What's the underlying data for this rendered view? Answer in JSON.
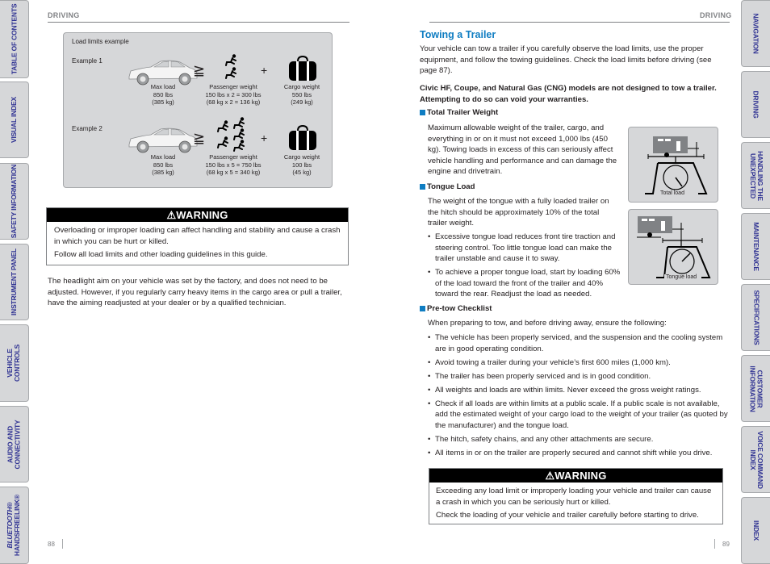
{
  "left_tabs": [
    {
      "label": "TABLE OF CONTENTS"
    },
    {
      "label": "VISUAL INDEX"
    },
    {
      "label": "SAFETY INFORMATION"
    },
    {
      "label": "INSTRUMENT PANEL"
    },
    {
      "label": "VEHICLE\nCONTROLS"
    },
    {
      "label": "AUDIO AND\nCONNECTIVITY"
    },
    {
      "label": "BLUETOOTH®\nHANDSFREELINK®"
    }
  ],
  "right_tabs": [
    {
      "label": "NAVIGATION"
    },
    {
      "label": "DRIVING"
    },
    {
      "label": "HANDLING THE\nUNEXPECTED"
    },
    {
      "label": "MAINTENANCE"
    },
    {
      "label": "SPECIFICATIONS"
    },
    {
      "label": "CUSTOMER\nINFORMATION"
    },
    {
      "label": "VOICE COMMAND\nINDEX"
    },
    {
      "label": "INDEX"
    }
  ],
  "left_page": {
    "section_header": "DRIVING",
    "page_number": "88",
    "figure": {
      "title": "Load limits example",
      "examples": [
        {
          "label": "Example 1",
          "passenger_count": 2,
          "max_load": "Max load\n850 lbs\n(385 kg)",
          "passenger_weight": "Passenger weight\n150 lbs x 2 = 300 lbs\n(68 kg x 2 = 136 kg)",
          "cargo_weight": "Cargo weight\n550 lbs\n(249 kg)"
        },
        {
          "label": "Example 2",
          "passenger_count": 5,
          "max_load": "Max load\n850 lbs\n(385 kg)",
          "passenger_weight": "Passenger weight\n150 lbs x 5 = 750 lbs\n(68 kg x 5 = 340 kg)",
          "cargo_weight": "Cargo weight\n100 lbs\n(45 kg)"
        }
      ],
      "operator_geq": "≧",
      "operator_plus": "+"
    },
    "warning": {
      "title": "⚠WARNING",
      "lines": [
        "Overloading or improper loading can affect handling and stability and cause a crash in which you can be hurt or killed.",
        "Follow all load limits and other loading guidelines in this guide."
      ]
    },
    "headlight_paragraph": "The headlight aim on your vehicle was set by the factory, and does not need to be adjusted. However, if you regularly carry heavy items in the cargo area or pull a trailer, have the aiming readjusted at your dealer or by a qualified technician."
  },
  "right_page": {
    "section_header": "DRIVING",
    "page_number": "89",
    "title": "Towing a Trailer",
    "intro": "Your vehicle can tow a trailer if you carefully observe the load limits, use the proper equipment, and follow the towing guidelines. Check the load limits before driving (see page 87).",
    "notice": "Civic HF, Coupe, and Natural Gas (CNG) models are not designed to tow a trailer. Attempting to do so can void your warranties.",
    "total_weight": {
      "heading": "Total Trailer Weight",
      "text": "Maximum allowable weight of the trailer, cargo, and everything in or on it must not exceed 1,000 lbs (450 kg). Towing loads in excess of this can seriously affect vehicle handling and performance and can damage the engine and drivetrain.",
      "figure_caption": "Total load"
    },
    "tongue_load": {
      "heading": "Tongue Load",
      "text": "The weight of the tongue with a fully loaded trailer on the hitch should be approximately 10% of the total trailer weight.",
      "bullets": [
        "Excessive tongue load reduces front tire traction and steering control. Too little tongue load can make the trailer unstable and cause it to sway.",
        "To achieve a proper tongue load, start by loading 60% of the load toward the front of the trailer and 40% toward the rear. Readjust the load as needed."
      ],
      "figure_caption": "Tongue load"
    },
    "pretow": {
      "heading": "Pre-tow Checklist",
      "intro": "When preparing to tow, and before driving away, ensure the following:",
      "bullets": [
        "The vehicle has been properly serviced, and the suspension and the cooling system are in good operating condition.",
        "Avoid towing a trailer during your vehicle’s first 600 miles (1,000 km).",
        "The trailer has been properly serviced and is in good condition.",
        "All weights and loads are within limits. Never exceed the gross weight ratings.",
        "Check if all loads are within limits at a public scale. If a public scale is not available, add the estimated weight of your cargo load to the weight of your trailer (as quoted by the manufacturer) and the tongue load.",
        "The hitch, safety chains, and any other attachments are secure.",
        "All items in or on the trailer are properly secured and cannot shift while you drive."
      ]
    },
    "warning": {
      "title": "⚠WARNING",
      "lines": [
        "Exceeding any load limit or improperly loading your vehicle and trailer can cause a crash in which you can be seriously hurt or killed.",
        "Check the loading of your vehicle and trailer carefully before starting to drive."
      ]
    }
  },
  "colors": {
    "accent_blue": "#0f7dc2",
    "tab_text": "#2e3192",
    "tab_bg": "#d6d7d9",
    "figure_bg": "#d6d7d9"
  }
}
